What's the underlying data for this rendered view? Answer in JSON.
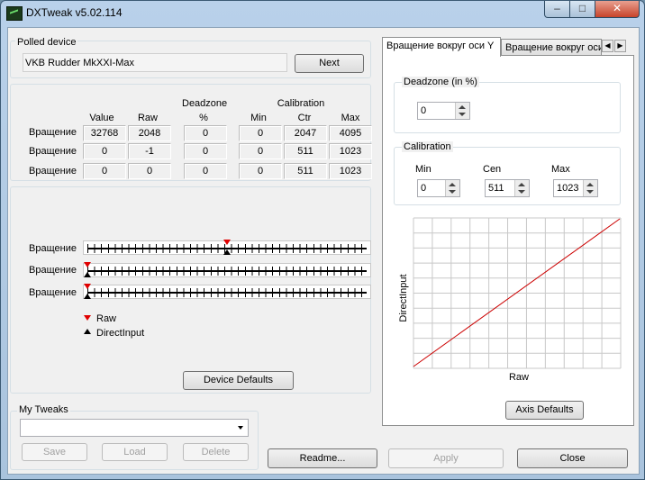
{
  "window": {
    "title": "DXTweak v5.02.114",
    "min_glyph": "–",
    "max_glyph": "□",
    "close_glyph": "✕"
  },
  "polled": {
    "label": "Polled device",
    "device_name": "VKB Rudder MkXXI-Max",
    "next_label": "Next"
  },
  "table": {
    "headers": {
      "deadzone_top": "Deadzone",
      "calibration_top": "Calibration",
      "value": "Value",
      "raw": "Raw",
      "deadzone_pct": "%",
      "min": "Min",
      "ctr": "Ctr",
      "max": "Max"
    },
    "rows": [
      {
        "label": "Вращение",
        "value": "32768",
        "raw": "2048",
        "deadzone": "0",
        "min": "0",
        "ctr": "2047",
        "max": "4095"
      },
      {
        "label": "Вращение",
        "value": "0",
        "raw": "-1",
        "deadzone": "0",
        "min": "0",
        "ctr": "511",
        "max": "1023"
      },
      {
        "label": "Вращение",
        "value": "0",
        "raw": "0",
        "deadzone": "0",
        "min": "0",
        "ctr": "511",
        "max": "1023"
      }
    ]
  },
  "sliders": [
    {
      "label": "Вращение",
      "position": 0.5
    },
    {
      "label": "Вращение",
      "position": 0.0
    },
    {
      "label": "Вращение",
      "position": 0.0
    }
  ],
  "legend": {
    "raw": "Raw",
    "directinput": "DirectInput",
    "raw_color": "#e00000",
    "di_color": "#000000"
  },
  "device_defaults_label": "Device Defaults",
  "my_tweaks": {
    "label": "My Tweaks",
    "selected": "",
    "save": "Save",
    "load": "Load",
    "delete": "Delete"
  },
  "tabs": [
    {
      "label": "Вращение вокруг оси Y",
      "active": true
    },
    {
      "label": "Вращение вокруг оси",
      "active": false
    }
  ],
  "tab_scroll": {
    "left": "◀",
    "right": "▶"
  },
  "axis": {
    "deadzone_group": "Deadzone (in %)",
    "deadzone_value": "0",
    "calibration_group": "Calibration",
    "min_label": "Min",
    "cen_label": "Cen",
    "max_label": "Max",
    "min_value": "0",
    "cen_value": "511",
    "max_value": "1023",
    "curve_ylabel": "DirectInput",
    "curve_xlabel": "Raw",
    "curve_color": "#cc0000",
    "axis_defaults_label": "Axis Defaults"
  },
  "bottom": {
    "readme": "Readme...",
    "apply": "Apply",
    "close": "Close"
  }
}
